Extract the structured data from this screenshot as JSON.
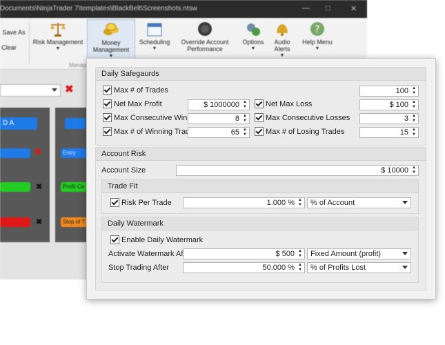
{
  "window": {
    "title": "Documents\\NinjaTrader 7\\templates\\BlackBelt\\Screenshots.ntsw"
  },
  "ribbon": {
    "save_as_label": "Save As",
    "clear_label": "Clear",
    "buttons": [
      {
        "label": "Risk Management",
        "icon": "scales-icon"
      },
      {
        "label": "Money Management",
        "icon": "coins-icon"
      },
      {
        "label": "Scheduling",
        "icon": "calendar-icon"
      },
      {
        "label": "Override Account Performance",
        "icon": "gauge-icon"
      },
      {
        "label": "Options",
        "icon": "gears-icon"
      },
      {
        "label": "Audio Alerts",
        "icon": "bell-icon"
      },
      {
        "label": "Help Menu",
        "icon": "help-icon"
      }
    ],
    "group_label": "Manage"
  },
  "background": {
    "pill_label": "D A",
    "row_labels": [
      "Entry",
      "Profit Ce",
      "Stop of T"
    ]
  },
  "dialog": {
    "daily_safeguards": {
      "title": "Daily Safegaurds",
      "max_trades_label": "Max # of Trades",
      "max_trades_value": "100",
      "net_max_profit_label": "Net Max Profit",
      "net_max_profit_value": "$ 1000000",
      "net_max_loss_label": "Net Max Loss",
      "net_max_loss_value": "$ 100",
      "max_consec_wins_label": "Max Consecutive Wins",
      "max_consec_wins_value": "8",
      "max_consec_losses_label": "Max Consecutive Losses",
      "max_consec_losses_value": "3",
      "max_winning_label": "Max # of Winning Trades",
      "max_winning_value": "65",
      "max_losing_label": "Max # of Losing Trades",
      "max_losing_value": "15"
    },
    "account_risk": {
      "title": "Account Risk",
      "account_size_label": "Account Size",
      "account_size_value": "$ 10000",
      "trade_fit": {
        "title": "Trade Fit",
        "risk_per_trade_label": "Risk Per Trade",
        "risk_per_trade_value": "1.000 %",
        "risk_mode": "% of Account"
      },
      "daily_watermark": {
        "title": "Daily Watermark",
        "enable_label": "Enable Daily Watermark",
        "activate_label": "Activate Watermark After",
        "activate_value": "$ 500",
        "activate_mode": "Fixed Amount (profit)",
        "stop_label": "Stop Trading After",
        "stop_value": "50.000 %",
        "stop_mode": "% of Profits Lost"
      }
    }
  },
  "colors": {
    "blue": "#1e7ae6",
    "green": "#22cc22",
    "red": "#e01818",
    "orange": "#f08a1e"
  }
}
